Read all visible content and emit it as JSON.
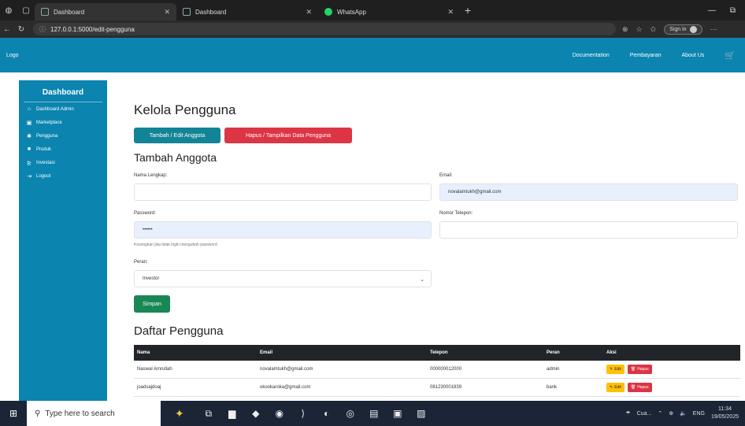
{
  "browser": {
    "tabs": [
      {
        "title": "Dashboard",
        "active": true
      },
      {
        "title": "Dashboard",
        "active": false
      },
      {
        "title": "WhatsApp",
        "active": false
      }
    ],
    "url": "127.0.0.1:5000/edit-pengguna",
    "signin_label": "Sign in"
  },
  "navbar": {
    "logo": "Logo",
    "links": [
      "Documentation",
      "Pembayaran",
      "About Us"
    ]
  },
  "sidebar": {
    "title": "Dashboard",
    "items": [
      {
        "icon": "home-icon",
        "glyph": "⌂",
        "label": "Dashboard Admin"
      },
      {
        "icon": "store-icon",
        "glyph": "▣",
        "label": "Marketplace"
      },
      {
        "icon": "users-icon",
        "glyph": "✱",
        "label": "Pengguna"
      },
      {
        "icon": "box-icon",
        "glyph": "■",
        "label": "Produk"
      },
      {
        "icon": "chart-icon",
        "glyph": "⊵",
        "label": "Investasi"
      },
      {
        "icon": "logout-icon",
        "glyph": "⇥",
        "label": "Logout"
      }
    ]
  },
  "main": {
    "page_title": "Kelola Pengguna",
    "btn_add": "Tambah / Edit Anggota",
    "btn_delete": "Hapus / Tampilkan Data Pengguna",
    "form_title": "Tambah Anggota",
    "form": {
      "name_label": "Nama Lengkap:",
      "name_value": "",
      "email_label": "Email:",
      "email_value": "novalamtukh@gmail.com",
      "password_label": "Password:",
      "password_value": "••••••",
      "password_hint": "Kosongkan jika tidak ingin mengubah password",
      "phone_label": "Nomor Telepon:",
      "phone_value": "",
      "role_label": "Peran:",
      "role_value": "Investor",
      "submit": "Simpan"
    },
    "list_title": "Daftar Pengguna",
    "table": {
      "headers": [
        "Nama",
        "Email",
        "Telepon",
        "Peran",
        "Aksi"
      ],
      "rows": [
        {
          "name": "Naswal Amrullah",
          "email": "novalamtukh@gmail.com",
          "phone": "000000012000",
          "role": "admin"
        },
        {
          "name": "joadsajdoaj",
          "email": "okookaroka@gmail.com",
          "phone": "081230001839",
          "role": "bank"
        }
      ],
      "edit_label": "Edit",
      "delete_label": "Hapus"
    }
  },
  "taskbar": {
    "search_placeholder": "Type here to search",
    "app_label": "Cua...",
    "lang": "ENG",
    "time": "11:34",
    "date": "19/05/2025"
  },
  "colors": {
    "primary": "#0b84b0",
    "info": "#138496",
    "danger": "#dc3545",
    "success": "#198754",
    "warning": "#ffc107",
    "table_header": "#212529"
  }
}
